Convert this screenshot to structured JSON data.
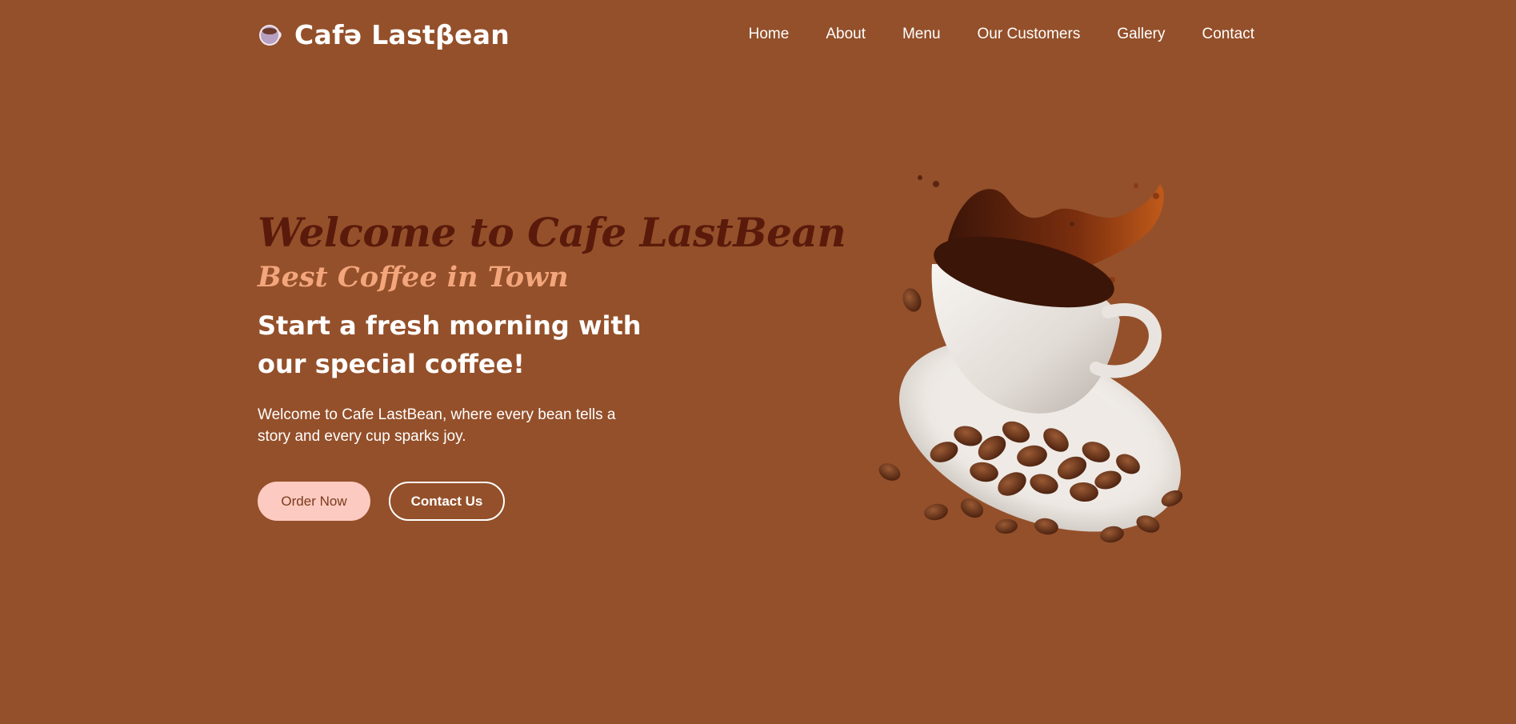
{
  "brand": {
    "name": "Cafə Lastβean",
    "logo_icon": "coffee-cup-icon"
  },
  "nav": {
    "items": [
      {
        "label": "Home"
      },
      {
        "label": "About"
      },
      {
        "label": "Menu"
      },
      {
        "label": "Our Customers"
      },
      {
        "label": "Gallery"
      },
      {
        "label": "Contact"
      }
    ]
  },
  "hero": {
    "title": "Welcome to Cafe LastBean",
    "tagline": "Best Coffee in Town",
    "heading": "Start a fresh morning with our special coffee!",
    "text": "Welcome to Cafe LastBean, where every bean tells a story and every cup sparks joy.",
    "order_label": "Order Now",
    "contact_label": "Contact Us",
    "image_icon": "coffee-splash-illustration"
  },
  "colors": {
    "background": "#94502a",
    "title": "#5a1a0b",
    "tagline": "#f3a57c",
    "order_button": "#fccac0"
  }
}
